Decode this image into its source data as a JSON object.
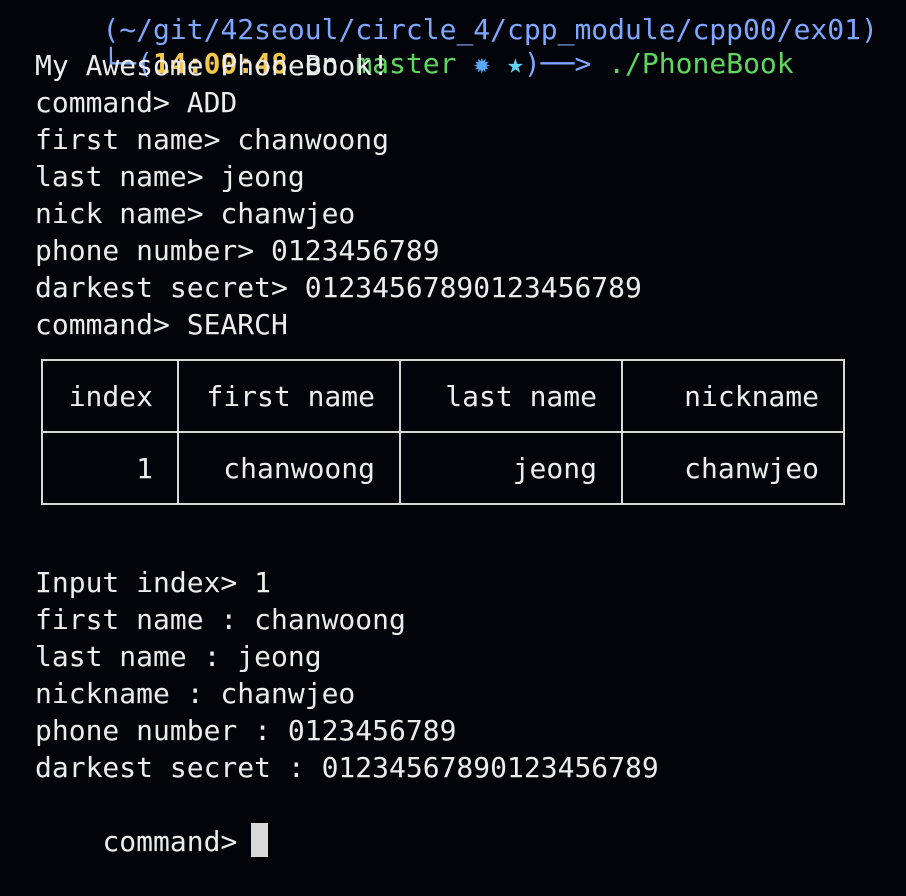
{
  "prompt": {
    "path_fragment": "(~/git/42seoul/circle_4/cpp_module/cpp00/ex01)",
    "open": "└─(",
    "time": "14:00:48",
    "on": "on",
    "branch": "master",
    "star1": "✹",
    "star2": "★",
    "close_arrow": ")──>",
    "command": "./PhoneBook"
  },
  "session_lines": [
    "My Awesome PhoneBook!",
    "command> ADD",
    "first name> chanwoong",
    "last name> jeong",
    "nick name> chanwjeo",
    "phone number> 0123456789",
    "darkest secret> 01234567890123456789",
    "command> SEARCH"
  ],
  "table": {
    "headers": [
      "index",
      "first name",
      "last name",
      "nickname"
    ],
    "rows": [
      [
        "1",
        "chanwoong",
        "jeong",
        "chanwjeo"
      ]
    ]
  },
  "detail_lines": [
    "Input index> 1",
    "first name : chanwoong",
    "last name : jeong",
    "nickname : chanwjeo",
    "phone number : 0123456789",
    "darkest secret : 01234567890123456789"
  ],
  "final_prompt": "command>",
  "colors": {
    "background": "#020409",
    "text": "#ececec",
    "time": "#f3c74e",
    "branch": "#5fd75f",
    "arrow": "#7ea7ff",
    "cursor": "#d9d9d9"
  }
}
